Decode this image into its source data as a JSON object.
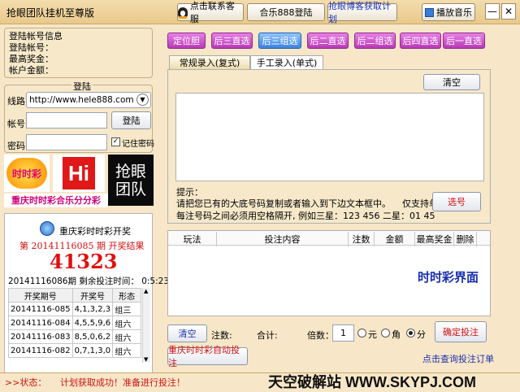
{
  "app": {
    "title": "抢眼团队挂机至尊版",
    "contact_label": "点击联系客服",
    "login_site_label": "合乐888登陆",
    "plan_label": "抢眼博客获取计划",
    "music_label": "播放音乐"
  },
  "account": {
    "heading": "登陆帐号信息",
    "account_label": "登陆帐号：",
    "max_bonus_label": "最高奖金：",
    "balance_label": "帐户金额："
  },
  "login": {
    "heading": "登陆",
    "line_label": "线路",
    "line_value": "http://www.hele888.com",
    "user_label": "帐号",
    "password_label": "密码",
    "login_button": "登陆",
    "remember_label": "记住密码",
    "remember_checked": true
  },
  "logos": {
    "shishicai_text": "时时彩",
    "hi_text": "Hi",
    "team_line1": "抢眼",
    "team_line2": "团队",
    "banner_text": "重庆时时彩合乐分分彩"
  },
  "lottery": {
    "name": "重庆彩时时彩开奖",
    "period_prefix": "第",
    "period": "20141116085",
    "period_suffix": "期 开奖结果",
    "result": "41323",
    "next_period": "20141116086期",
    "remaining_label": "剩余投注时间：",
    "remaining_time": "0:5:23",
    "headers": [
      "开奖期号",
      "开奖号",
      "形态"
    ],
    "rows": [
      [
        "20141116-085",
        "4,1,3,2,3",
        "组三"
      ],
      [
        "20141116-084",
        "4,5,5,9,6",
        "组六"
      ],
      [
        "20141116-083",
        "8,5,0,6,2",
        "组六"
      ],
      [
        "20141116-082",
        "0,7,1,3,0",
        "组六"
      ]
    ]
  },
  "play_tabs": [
    {
      "label": "定位胆",
      "active": false
    },
    {
      "label": "后三直选",
      "active": false
    },
    {
      "label": "后三组选",
      "active": true
    },
    {
      "label": "后二直选",
      "active": false
    },
    {
      "label": "后二组选",
      "active": false
    },
    {
      "label": "后四直选",
      "active": false
    },
    {
      "label": "后一直选",
      "active": false
    }
  ],
  "input_tabs": [
    {
      "label": "常规录入(复式)",
      "active": false
    },
    {
      "label": "手工录入(单式)",
      "active": true
    }
  ],
  "entry": {
    "clear_label": "清空",
    "hint_title": "提示：",
    "hint_line1": "请把您已有的大底号码复制或者输入到下边文本框中。    仅支持单式",
    "hint_line2": "每注号码之间必须用空格隔开, 例如三星：123 456 二星：01 45",
    "select_label": "选号"
  },
  "bet_table": {
    "headers": [
      "玩法",
      "投注内容",
      "注数",
      "金额",
      "最高奖金",
      "删除"
    ],
    "watermark": "时时彩界面"
  },
  "footer": {
    "clear_label": "清空",
    "count_label": "注数:",
    "total_label": "合计:",
    "multiple_label": "倍数：",
    "multiple_value": "1",
    "unit_yuan": "元",
    "unit_jiao": "角",
    "unit_fen": "分",
    "unit_selected": "分",
    "confirm_label": "确定投注",
    "auto_bet_label": "重庆时时彩自动投注",
    "query_label": "点击查询投注订单"
  },
  "status": {
    "prefix": ">>状态：",
    "message": "计划获取成功！准备进行投注！",
    "watermark": "天空破解站 WWW.SKYPJ.COM"
  }
}
